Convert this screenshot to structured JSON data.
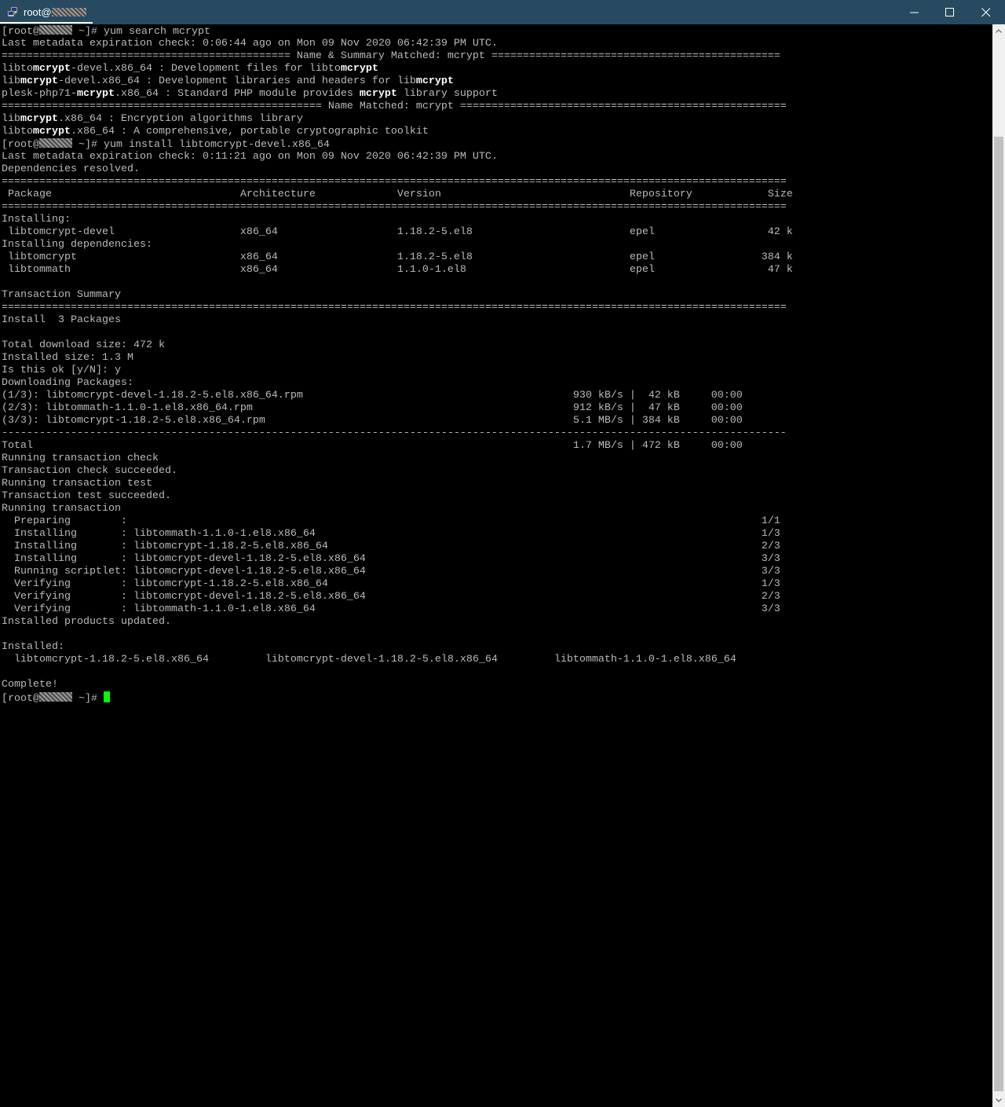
{
  "window": {
    "title_prefix": "root@",
    "icon": "putty-icon",
    "controls": {
      "minimize": "minimize-icon",
      "maximize": "maximize-icon",
      "close": "close-icon"
    }
  },
  "colors": {
    "titlebar": "#284a60",
    "terminal_bg": "#000000",
    "terminal_fg": "#bbbbbb",
    "highlight": "#ffffff",
    "cursor": "#00ff00"
  },
  "terminal": {
    "lines": [
      [
        {
          "p": true
        },
        {
          "t": " ~]# yum search mcrypt"
        }
      ],
      [
        {
          "t": "Last metadata expiration check: 0:06:44 ago on Mon 09 Nov 2020 06:42:39 PM UTC."
        }
      ],
      [
        {
          "t": "============================================== Name & Summary Matched: mcrypt =============================================="
        }
      ],
      [
        {
          "t": "libto"
        },
        {
          "t": "mcrypt",
          "h": true
        },
        {
          "t": "-devel.x86_64 : Development files for libto"
        },
        {
          "t": "mcrypt",
          "h": true
        }
      ],
      [
        {
          "t": "lib"
        },
        {
          "t": "mcrypt",
          "h": true
        },
        {
          "t": "-devel.x86_64 : Development libraries and headers for lib"
        },
        {
          "t": "mcrypt",
          "h": true
        }
      ],
      [
        {
          "t": "plesk-php71-"
        },
        {
          "t": "mcrypt",
          "h": true
        },
        {
          "t": ".x86_64 : Standard PHP module provides "
        },
        {
          "t": "mcrypt",
          "h": true
        },
        {
          "t": " library support"
        }
      ],
      [
        {
          "t": "=================================================== Name Matched: mcrypt ===================================================="
        }
      ],
      [
        {
          "t": "lib"
        },
        {
          "t": "mcrypt",
          "h": true
        },
        {
          "t": ".x86_64 : Encryption algorithms library"
        }
      ],
      [
        {
          "t": "libto"
        },
        {
          "t": "mcrypt",
          "h": true
        },
        {
          "t": ".x86_64 : A comprehensive, portable cryptographic toolkit"
        }
      ],
      [
        {
          "p": true
        },
        {
          "t": " ~]# yum install libtomcrypt-devel.x86_64"
        }
      ],
      [
        {
          "t": "Last metadata expiration check: 0:11:21 ago on Mon 09 Nov 2020 06:42:39 PM UTC."
        }
      ],
      [
        {
          "t": "Dependencies resolved."
        }
      ],
      [
        {
          "t": "============================================================================================================================="
        }
      ],
      [
        {
          "t": " Package                              Architecture             Version                              Repository            Size"
        }
      ],
      [
        {
          "t": "============================================================================================================================="
        }
      ],
      [
        {
          "t": "Installing:"
        }
      ],
      [
        {
          "t": " libtomcrypt-devel                    x86_64                   1.18.2-5.el8                         epel                  42 k"
        }
      ],
      [
        {
          "t": "Installing dependencies:"
        }
      ],
      [
        {
          "t": " libtomcrypt                          x86_64                   1.18.2-5.el8                         epel                 384 k"
        }
      ],
      [
        {
          "t": " libtommath                           x86_64                   1.1.0-1.el8                          epel                  47 k"
        }
      ],
      [
        {
          "t": ""
        }
      ],
      [
        {
          "t": "Transaction Summary"
        }
      ],
      [
        {
          "t": "============================================================================================================================="
        }
      ],
      [
        {
          "t": "Install  3 Packages"
        }
      ],
      [
        {
          "t": ""
        }
      ],
      [
        {
          "t": "Total download size: 472 k"
        }
      ],
      [
        {
          "t": "Installed size: 1.3 M"
        }
      ],
      [
        {
          "t": "Is this ok [y/N]: y"
        }
      ],
      [
        {
          "t": "Downloading Packages:"
        }
      ],
      [
        {
          "t": "(1/3): libtomcrypt-devel-1.18.2-5.el8.x86_64.rpm                                           930 kB/s |  42 kB     00:00"
        }
      ],
      [
        {
          "t": "(2/3): libtommath-1.1.0-1.el8.x86_64.rpm                                                   912 kB/s |  47 kB     00:00"
        }
      ],
      [
        {
          "t": "(3/3): libtomcrypt-1.18.2-5.el8.x86_64.rpm                                                 5.1 MB/s | 384 kB     00:00"
        }
      ],
      [
        {
          "t": "-----------------------------------------------------------------------------------------------------------------------------"
        }
      ],
      [
        {
          "t": "Total                                                                                      1.7 MB/s | 472 kB     00:00"
        }
      ],
      [
        {
          "t": "Running transaction check"
        }
      ],
      [
        {
          "t": "Transaction check succeeded."
        }
      ],
      [
        {
          "t": "Running transaction test"
        }
      ],
      [
        {
          "t": "Transaction test succeeded."
        }
      ],
      [
        {
          "t": "Running transaction"
        }
      ],
      [
        {
          "t": "  Preparing        :                                                                                                     1/1"
        }
      ],
      [
        {
          "t": "  Installing       : libtommath-1.1.0-1.el8.x86_64                                                                       1/3"
        }
      ],
      [
        {
          "t": "  Installing       : libtomcrypt-1.18.2-5.el8.x86_64                                                                     2/3"
        }
      ],
      [
        {
          "t": "  Installing       : libtomcrypt-devel-1.18.2-5.el8.x86_64                                                               3/3"
        }
      ],
      [
        {
          "t": "  Running scriptlet: libtomcrypt-devel-1.18.2-5.el8.x86_64                                                               3/3"
        }
      ],
      [
        {
          "t": "  Verifying        : libtomcrypt-1.18.2-5.el8.x86_64                                                                     1/3"
        }
      ],
      [
        {
          "t": "  Verifying        : libtomcrypt-devel-1.18.2-5.el8.x86_64                                                               2/3"
        }
      ],
      [
        {
          "t": "  Verifying        : libtommath-1.1.0-1.el8.x86_64                                                                       3/3"
        }
      ],
      [
        {
          "t": "Installed products updated."
        }
      ],
      [
        {
          "t": ""
        }
      ],
      [
        {
          "t": "Installed:"
        }
      ],
      [
        {
          "t": "  libtomcrypt-1.18.2-5.el8.x86_64         libtomcrypt-devel-1.18.2-5.el8.x86_64         libtommath-1.1.0-1.el8.x86_64"
        }
      ],
      [
        {
          "t": ""
        }
      ],
      [
        {
          "t": "Complete!"
        }
      ],
      [
        {
          "p": true
        },
        {
          "t": " ~]# "
        },
        {
          "c": true
        }
      ]
    ]
  }
}
